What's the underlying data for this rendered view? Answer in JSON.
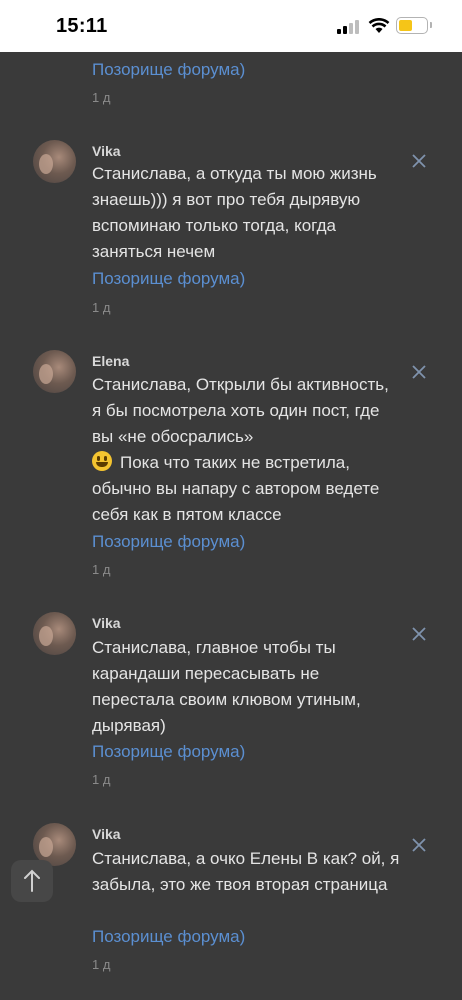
{
  "status_bar": {
    "time": "15:11"
  },
  "top_partial": {
    "link": "Позорище форума)",
    "time": "1 д"
  },
  "comments": [
    {
      "author": "Vika",
      "text": "Станислава, а откуда ты мою жизнь знаешь))) я вот про тебя дырявую вспоминаю только тогда, когда заняться нечем",
      "link": "Позорище форума)",
      "time": "1 д"
    },
    {
      "author": "Elena",
      "text_before_emoji": "Станислава, Открыли бы активность, я бы посмотрела хоть один пост, где вы «не обосрались»",
      "text_after_emoji": "Пока что таких не встретила, обычно вы напару с автором ведете себя как в пятом классе",
      "link": "Позорище форума)",
      "time": "1 д"
    },
    {
      "author": "Vika",
      "text": "Станислава, главное чтобы ты карандаши пересасывать не перестала своим клювом утиным, дырявая)",
      "link": "Позорище форума)",
      "time": "1 д"
    },
    {
      "author": "Vika",
      "text": "Станислава, а очко Елены В как? ой, я забыла, это же твоя вторая страница",
      "link": "Позорище форума)",
      "time": "1 д"
    }
  ]
}
